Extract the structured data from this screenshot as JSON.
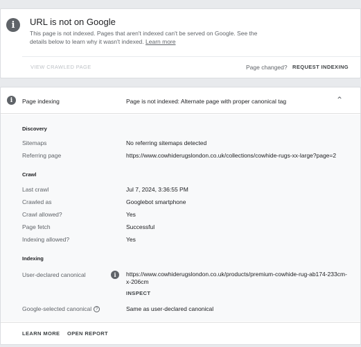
{
  "top_card": {
    "icon": "info-icon",
    "icon_glyph": "i",
    "title": "URL is not on Google",
    "description": "This page is not indexed. Pages that aren't indexed can't be served on Google. See the details below to learn why it wasn't indexed.",
    "learn_more_link": "Learn more",
    "view_crawled_label": "VIEW CRAWLED PAGE",
    "page_changed_text": "Page changed?",
    "request_indexing_label": "REQUEST INDEXING"
  },
  "indexing_card": {
    "icon": "info-icon",
    "icon_glyph": "i",
    "label": "Page indexing",
    "status": "Page is not indexed: Alternate page with proper canonical tag",
    "chevron_icon": "chevron-up-icon",
    "chevron_glyph": "⌃",
    "discovery": {
      "title": "Discovery",
      "sitemaps_label": "Sitemaps",
      "sitemaps_value": "No referring sitemaps detected",
      "referring_label": "Referring page",
      "referring_value": "https://www.cowhiderugslondon.co.uk/collections/cowhide-rugs-xx-large?page=2"
    },
    "crawl": {
      "title": "Crawl",
      "last_crawl_label": "Last crawl",
      "last_crawl_value": "Jul 7, 2024, 3:36:55 PM",
      "crawled_as_label": "Crawled as",
      "crawled_as_value": "Googlebot smartphone",
      "crawl_allowed_label": "Crawl allowed?",
      "crawl_allowed_value": "Yes",
      "page_fetch_label": "Page fetch",
      "page_fetch_value": "Successful",
      "indexing_allowed_label": "Indexing allowed?",
      "indexing_allowed_value": "Yes"
    },
    "indexing": {
      "title": "Indexing",
      "user_canonical_label": "User-declared canonical",
      "user_canonical_info_glyph": "i",
      "user_canonical_value": "https://www.cowhiderugslondon.co.uk/products/premium-cowhide-rug-ab174-233cm-x-206cm",
      "inspect_label": "INSPECT",
      "google_canonical_label": "Google-selected canonical",
      "google_canonical_help_glyph": "?",
      "google_canonical_value": "Same as user-declared canonical"
    },
    "footer": {
      "learn_more_label": "LEARN MORE",
      "open_report_label": "OPEN REPORT"
    }
  },
  "colors": {
    "background": "#e8eaed",
    "card": "#ffffff",
    "details_bg": "#f8f9fa",
    "icon_gray": "#5f6368",
    "text_primary": "#202124",
    "text_secondary": "#5f6368",
    "disabled": "#bdc1c6"
  }
}
